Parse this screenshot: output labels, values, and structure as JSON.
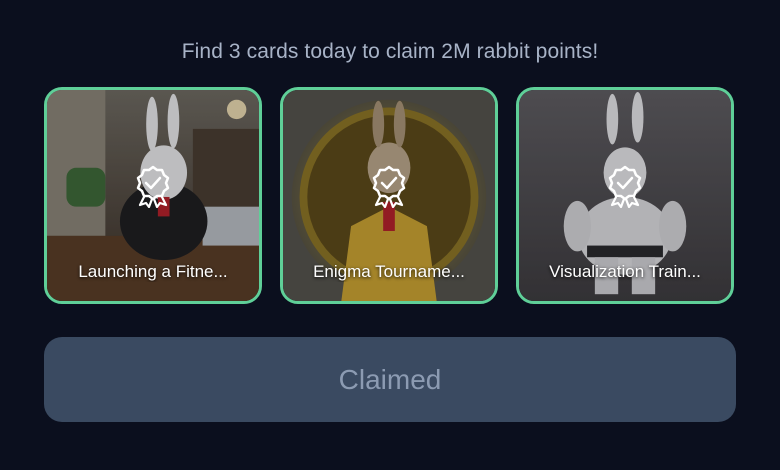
{
  "header": {
    "text": "Find 3 cards today to claim 2M rabbit points!"
  },
  "cards": [
    {
      "title": "Launching a Fitne...",
      "icon": "claimed-badge-icon"
    },
    {
      "title": "Enigma Tourname...",
      "icon": "claimed-badge-icon"
    },
    {
      "title": "Visualization Train...",
      "icon": "claimed-badge-icon"
    }
  ],
  "claim_button": {
    "label": "Claimed",
    "state": "disabled"
  },
  "colors": {
    "background": "#0b0f1e",
    "card_border": "#5fcf98",
    "button_bg": "#3a4a61",
    "button_text": "#8c9bb2",
    "headline_text": "#a8b3c7"
  }
}
